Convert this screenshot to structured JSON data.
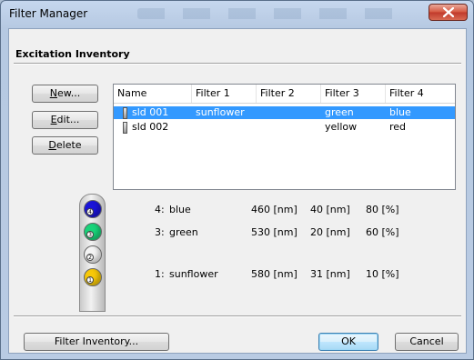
{
  "window": {
    "title": "Filter Manager"
  },
  "section": {
    "title": "Excitation Inventory"
  },
  "buttons": {
    "new": {
      "label": "New...",
      "accel": "N",
      "rest": "ew..."
    },
    "edit": {
      "label": "Edit...",
      "accel": "E",
      "rest": "dit..."
    },
    "delete": {
      "label": "Delete",
      "accel": "D",
      "rest": "elete"
    },
    "filter_inventory": "Filter Inventory...",
    "ok": "OK",
    "cancel": "Cancel"
  },
  "table": {
    "columns": [
      "Name",
      "Filter 1",
      "Filter 2",
      "Filter 3",
      "Filter 4"
    ],
    "rows": [
      {
        "name": "sld 001",
        "filter1": "sunflower",
        "filter2": "",
        "filter3": "green",
        "filter4": "blue",
        "selected": true
      },
      {
        "name": "sld 002",
        "filter1": "",
        "filter2": "",
        "filter3": "yellow",
        "filter4": "red",
        "selected": false
      }
    ]
  },
  "wheel": {
    "disks": [
      {
        "num": "4",
        "color": "#1a14d8"
      },
      {
        "num": "3",
        "color": "#19d47a"
      },
      {
        "num": "2",
        "color": "#f4f4f4"
      },
      {
        "num": "1",
        "color": "#f7c808"
      }
    ]
  },
  "details": [
    {
      "slot": "4:",
      "name": "blue",
      "wavelength": "460 [nm]",
      "bandwidth": "40 [nm]",
      "transmission": "80 [%]"
    },
    {
      "slot": "3:",
      "name": "green",
      "wavelength": "530 [nm]",
      "bandwidth": "20 [nm]",
      "transmission": "60 [%]"
    },
    {
      "slot": "1:",
      "name": "sunflower",
      "wavelength": "580 [nm]",
      "bandwidth": "31 [nm]",
      "transmission": "10 [%]"
    }
  ]
}
